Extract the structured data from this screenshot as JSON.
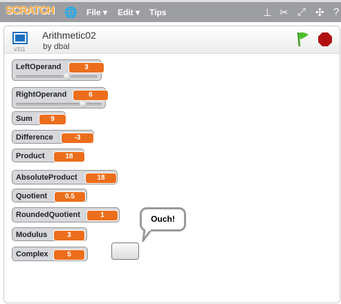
{
  "menubar": {
    "logo": "SCRATCH",
    "file": "File ▾",
    "edit": "Edit ▾",
    "tips": "Tips"
  },
  "project": {
    "title": "Arithmetic02",
    "author": "by dbal",
    "version": "v311"
  },
  "monitors": [
    {
      "label": "LeftOperand",
      "value": "3",
      "slider": 0.63
    },
    {
      "label": "RightOperand",
      "value": "6",
      "slider": 0.78
    },
    {
      "label": "Sum",
      "value": "9"
    },
    {
      "label": "Difference",
      "value": "-3"
    },
    {
      "label": "Product",
      "value": "18"
    },
    {
      "label": "AbsoluteProduct",
      "value": "18"
    },
    {
      "label": "Quotient",
      "value": "0.5"
    },
    {
      "label": "RoundedQuotient",
      "value": "1"
    },
    {
      "label": "Modulus",
      "value": "3"
    },
    {
      "label": "Complex",
      "value": "5"
    }
  ],
  "speech_bubble": "Ouch!",
  "colors": {
    "monitor_value": "#ec6e1c",
    "green_flag": "#4cbf2a",
    "stop": "#b01010"
  }
}
